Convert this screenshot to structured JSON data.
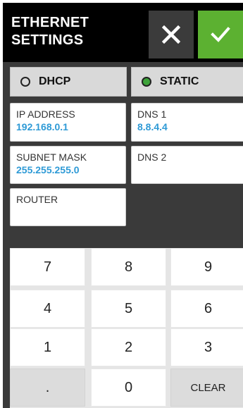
{
  "header": {
    "title": "ETHERNET\nSETTINGS",
    "cancel_icon": "close-icon",
    "confirm_icon": "checkmark-icon",
    "confirm_color": "#5cb131"
  },
  "mode": {
    "options": [
      {
        "label": "DHCP",
        "selected": false
      },
      {
        "label": "STATIC",
        "selected": true
      }
    ]
  },
  "fields": {
    "ip_address": {
      "label": "IP ADDRESS",
      "value": "192.168.0.1"
    },
    "subnet_mask": {
      "label": "SUBNET MASK",
      "value": "255.255.255.0"
    },
    "router": {
      "label": "ROUTER",
      "value": ""
    },
    "dns1": {
      "label": "DNS 1",
      "value": "8.8.4.4"
    },
    "dns2": {
      "label": "DNS 2",
      "value": ""
    }
  },
  "keypad": {
    "keys": [
      "7",
      "8",
      "9",
      "4",
      "5",
      "6",
      "1",
      "2",
      "3",
      ".",
      "0",
      "CLEAR"
    ]
  },
  "colors": {
    "value_text": "#2e9ad6",
    "radio_selected": "#3da33a"
  }
}
